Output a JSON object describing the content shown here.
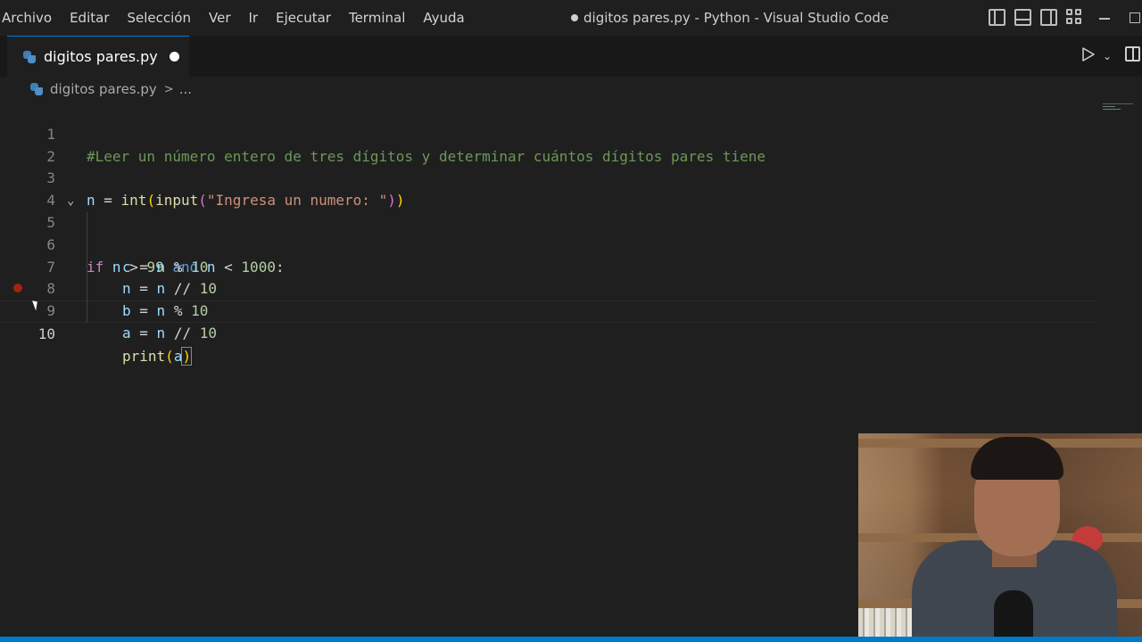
{
  "menu": [
    "Archivo",
    "Editar",
    "Selección",
    "Ver",
    "Ir",
    "Ejecutar",
    "Terminal",
    "Ayuda"
  ],
  "window_title": "digitos pares.py - Python - Visual Studio Code",
  "tab": {
    "label": "digitos pares.py",
    "dirty": true
  },
  "breadcrumb": {
    "file": "digitos pares.py",
    "more": "..."
  },
  "editor": {
    "line_numbers": [
      "1",
      "2",
      "3",
      "4",
      "5",
      "6",
      "7",
      "8",
      "9",
      "10"
    ],
    "comment": "#Leer un número entero de tres dígitos y determinar cuántos dígitos pares tiene",
    "line3": {
      "var": "n",
      "eq": " = ",
      "fn1": "int",
      "p1": "(",
      "fn2": "input",
      "p2": "(",
      "str": "\"Ingresa un numero: \"",
      "p3": ")",
      "p4": ")"
    },
    "line5": {
      "kw": "if",
      "a": " n ",
      "op1": "> ",
      "num1": "99",
      "sp": " ",
      "kw2": "and",
      "b": " n ",
      "op2": "< ",
      "num2": "1000",
      "colon": ":"
    },
    "line6": {
      "var": "c",
      "rest": " = ",
      "v2": "n",
      "op": " % ",
      "num": "10"
    },
    "line7": {
      "var": "n",
      "rest": " = ",
      "v2": "n",
      "op": " // ",
      "num": "10"
    },
    "line8": {
      "var": "b",
      "rest": " = ",
      "v2": "n",
      "op": " % ",
      "num": "10"
    },
    "line9": {
      "var": "a",
      "rest": " = ",
      "v2": "n",
      "op": " // ",
      "num": "10"
    },
    "line10": {
      "fn": "print",
      "p1": "(",
      "arg": "a",
      "p2": ")"
    },
    "breakpoint_line": "9",
    "active_line": "10"
  },
  "colors": {
    "accent": "#007acc",
    "comment": "#6a9955",
    "string": "#ce9178",
    "number": "#b5cea8",
    "keyword": "#c586c0",
    "function": "#dcdcaa",
    "variable": "#9cdcfe"
  },
  "icons": [
    "python-file-icon",
    "run-icon",
    "split-editor-icon",
    "layout-icons",
    "breakpoint-icon",
    "fold-chevron-icon"
  ]
}
